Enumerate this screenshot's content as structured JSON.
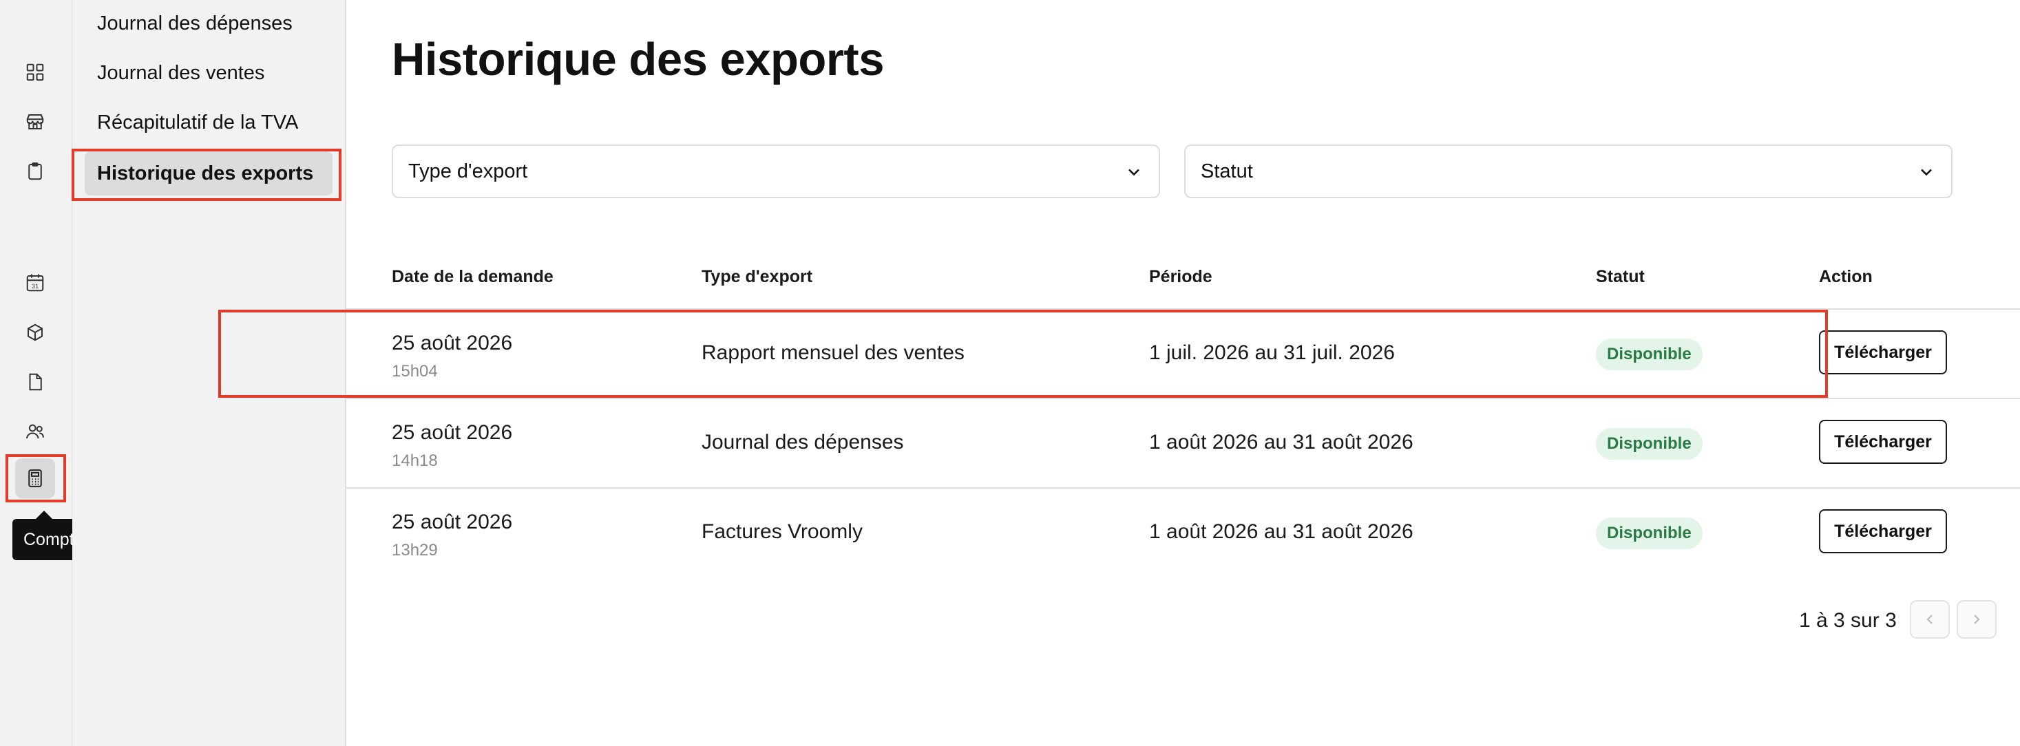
{
  "rail": {
    "icons": [
      "dashboard-icon",
      "store-icon",
      "clipboard-icon",
      "calendar-icon",
      "package-icon",
      "file-icon",
      "users-icon",
      "calculator-icon"
    ],
    "calendar_day": "31",
    "tooltip": "Comptabilité"
  },
  "subnav": {
    "items": [
      {
        "label": "Journal des dépenses"
      },
      {
        "label": "Journal des ventes"
      },
      {
        "label": "Récapitulatif de la TVA"
      },
      {
        "label": "Historique des exports"
      }
    ]
  },
  "main": {
    "title": "Historique des exports",
    "filters": {
      "type_placeholder": "Type d'export",
      "status_placeholder": "Statut"
    },
    "table": {
      "headers": [
        "Date de la demande",
        "Type d'export",
        "Période",
        "Statut",
        "Action"
      ],
      "rows": [
        {
          "date": "25 août 2026",
          "time": "15h04",
          "type": "Rapport mensuel des ventes",
          "period": "1 juil. 2026 au 31 juil. 2026",
          "status": "Disponible",
          "action": "Télécharger"
        },
        {
          "date": "25 août 2026",
          "time": "14h18",
          "type": "Journal des dépenses",
          "period": "1 août 2026 au 31 août 2026",
          "status": "Disponible",
          "action": "Télécharger"
        },
        {
          "date": "25 août 2026",
          "time": "13h29",
          "type": "Factures Vroomly",
          "period": "1 août 2026 au 31 août 2026",
          "status": "Disponible",
          "action": "Télécharger"
        }
      ]
    },
    "pagination": {
      "label": "1 à 3 sur 3"
    }
  },
  "colors": {
    "highlight": "#e23b2a",
    "badge_bg": "#e3f5e8",
    "badge_text": "#2a7a43"
  }
}
